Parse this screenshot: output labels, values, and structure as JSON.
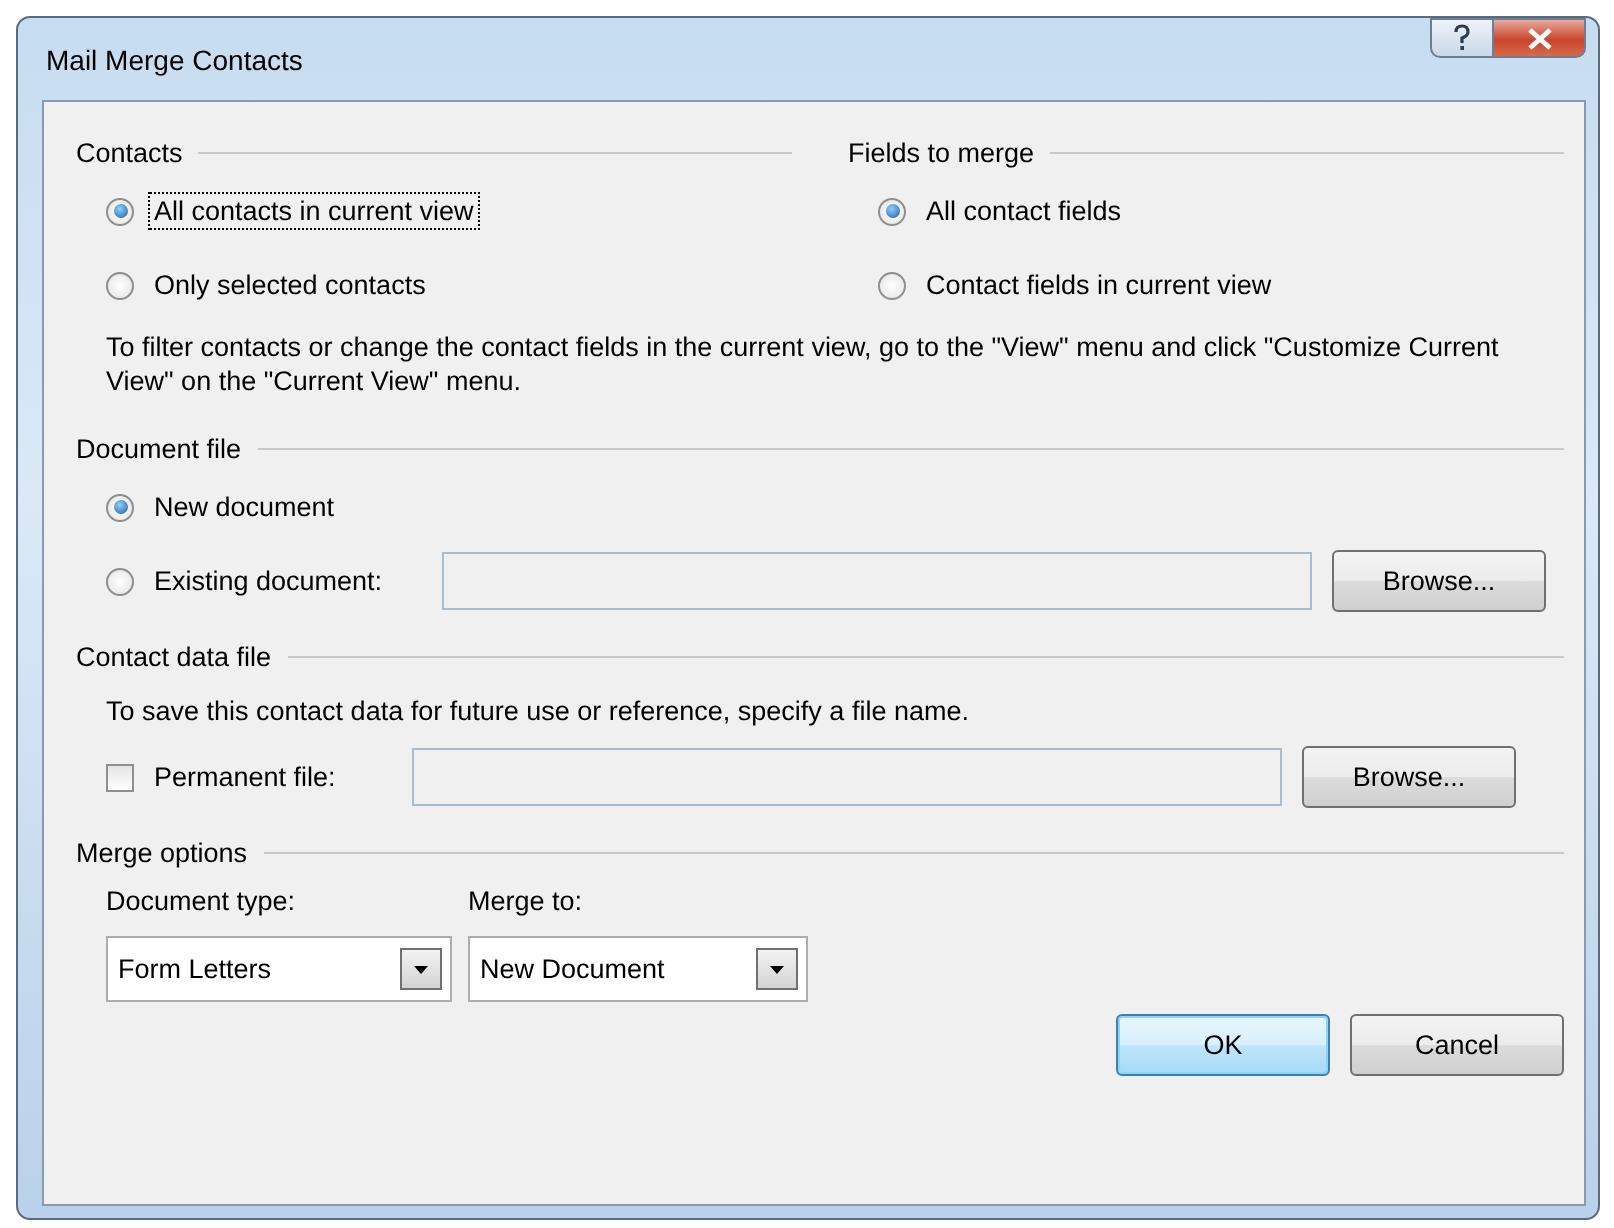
{
  "window": {
    "title": "Mail Merge Contacts"
  },
  "contacts": {
    "label": "Contacts",
    "options": [
      {
        "label": "All contacts in current view",
        "selected": true,
        "focused": true
      },
      {
        "label": "Only selected contacts",
        "selected": false,
        "focused": false
      }
    ]
  },
  "fields_to_merge": {
    "label": "Fields to merge",
    "options": [
      {
        "label": "All contact fields",
        "selected": true,
        "focused": false
      },
      {
        "label": "Contact fields in current view",
        "selected": false,
        "focused": false
      }
    ]
  },
  "view_note": "To filter contacts or change the contact fields in the current view, go to the \"View\" menu and click \"Customize Current View\" on the \"Current View\" menu.",
  "document_file": {
    "label": "Document file",
    "options": [
      {
        "label": "New document",
        "selected": true,
        "focused": false
      },
      {
        "label": "Existing document:",
        "selected": false,
        "focused": false
      }
    ],
    "browse": "Browse..."
  },
  "contact_data_file": {
    "label": "Contact data file",
    "note": "To save this contact data for future use or reference, specify a file name.",
    "permanent_file": {
      "label": "Permanent file:",
      "checked": false
    },
    "browse": "Browse..."
  },
  "merge_options": {
    "label": "Merge options",
    "document_type": {
      "label": "Document type:",
      "value": "Form Letters"
    },
    "merge_to": {
      "label": "Merge to:",
      "value": "New Document"
    }
  },
  "buttons": [
    {
      "label": "OK",
      "default": true
    },
    {
      "label": "Cancel",
      "default": false
    }
  ]
}
